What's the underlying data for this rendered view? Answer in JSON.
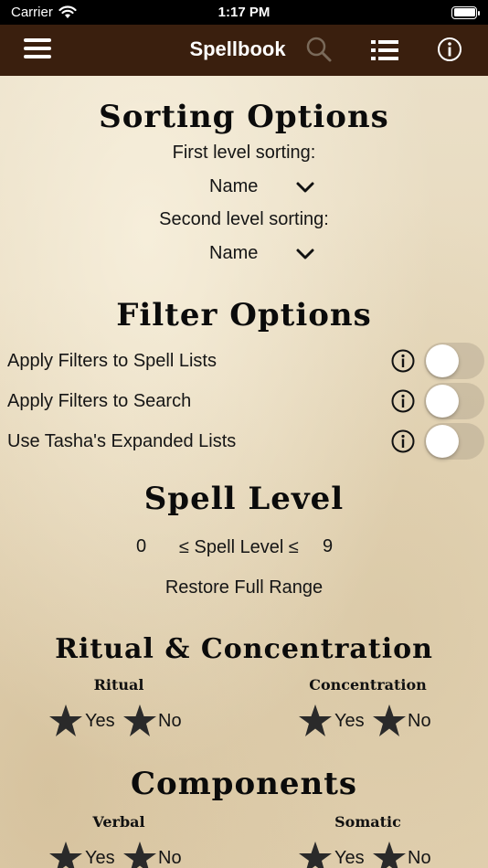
{
  "status_bar": {
    "carrier": "Carrier",
    "time": "1:17 PM"
  },
  "nav": {
    "title": "Spellbook",
    "icons": [
      "hamburger-icon",
      "search-icon",
      "list-icon",
      "info-icon"
    ],
    "bar_color": "#3a1f0e",
    "search_icon_color": "#7a6a5a"
  },
  "sorting": {
    "title": "Sorting Options",
    "first_label": "First level sorting:",
    "first_value": "Name",
    "second_label": "Second level sorting:",
    "second_value": "Name"
  },
  "filters": {
    "title": "Filter Options",
    "rows": [
      {
        "label": "Apply Filters to Spell Lists",
        "on": false
      },
      {
        "label": "Apply Filters to Search",
        "on": false
      },
      {
        "label": "Use Tasha's Expanded Lists",
        "on": false
      }
    ]
  },
  "spell_level": {
    "title": "Spell Level",
    "min": "0",
    "range_label": "≤ Spell Level ≤",
    "max": "9",
    "restore_label": "Restore Full Range"
  },
  "ritual_concentration": {
    "title": "Ritual & Concentration",
    "ritual_label": "Ritual",
    "concentration_label": "Concentration",
    "yes": "Yes",
    "no": "No"
  },
  "components": {
    "title": "Components",
    "verbal_label": "Verbal",
    "somatic_label": "Somatic",
    "yes": "Yes",
    "no": "No"
  }
}
